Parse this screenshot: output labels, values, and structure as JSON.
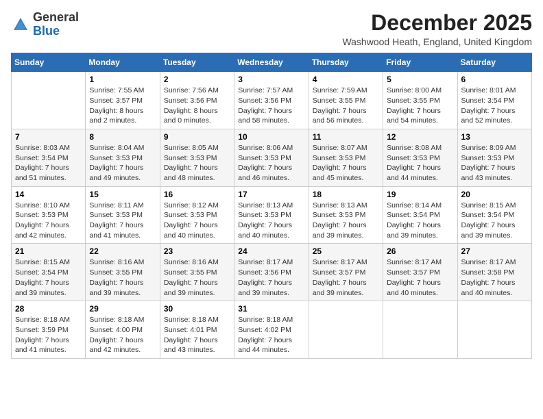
{
  "logo": {
    "general": "General",
    "blue": "Blue"
  },
  "header": {
    "month_year": "December 2025",
    "location": "Washwood Heath, England, United Kingdom"
  },
  "days_of_week": [
    "Sunday",
    "Monday",
    "Tuesday",
    "Wednesday",
    "Thursday",
    "Friday",
    "Saturday"
  ],
  "weeks": [
    [
      {
        "day": "",
        "info": ""
      },
      {
        "day": "1",
        "info": "Sunrise: 7:55 AM\nSunset: 3:57 PM\nDaylight: 8 hours\nand 2 minutes."
      },
      {
        "day": "2",
        "info": "Sunrise: 7:56 AM\nSunset: 3:56 PM\nDaylight: 8 hours\nand 0 minutes."
      },
      {
        "day": "3",
        "info": "Sunrise: 7:57 AM\nSunset: 3:56 PM\nDaylight: 7 hours\nand 58 minutes."
      },
      {
        "day": "4",
        "info": "Sunrise: 7:59 AM\nSunset: 3:55 PM\nDaylight: 7 hours\nand 56 minutes."
      },
      {
        "day": "5",
        "info": "Sunrise: 8:00 AM\nSunset: 3:55 PM\nDaylight: 7 hours\nand 54 minutes."
      },
      {
        "day": "6",
        "info": "Sunrise: 8:01 AM\nSunset: 3:54 PM\nDaylight: 7 hours\nand 52 minutes."
      }
    ],
    [
      {
        "day": "7",
        "info": "Sunrise: 8:03 AM\nSunset: 3:54 PM\nDaylight: 7 hours\nand 51 minutes."
      },
      {
        "day": "8",
        "info": "Sunrise: 8:04 AM\nSunset: 3:53 PM\nDaylight: 7 hours\nand 49 minutes."
      },
      {
        "day": "9",
        "info": "Sunrise: 8:05 AM\nSunset: 3:53 PM\nDaylight: 7 hours\nand 48 minutes."
      },
      {
        "day": "10",
        "info": "Sunrise: 8:06 AM\nSunset: 3:53 PM\nDaylight: 7 hours\nand 46 minutes."
      },
      {
        "day": "11",
        "info": "Sunrise: 8:07 AM\nSunset: 3:53 PM\nDaylight: 7 hours\nand 45 minutes."
      },
      {
        "day": "12",
        "info": "Sunrise: 8:08 AM\nSunset: 3:53 PM\nDaylight: 7 hours\nand 44 minutes."
      },
      {
        "day": "13",
        "info": "Sunrise: 8:09 AM\nSunset: 3:53 PM\nDaylight: 7 hours\nand 43 minutes."
      }
    ],
    [
      {
        "day": "14",
        "info": "Sunrise: 8:10 AM\nSunset: 3:53 PM\nDaylight: 7 hours\nand 42 minutes."
      },
      {
        "day": "15",
        "info": "Sunrise: 8:11 AM\nSunset: 3:53 PM\nDaylight: 7 hours\nand 41 minutes."
      },
      {
        "day": "16",
        "info": "Sunrise: 8:12 AM\nSunset: 3:53 PM\nDaylight: 7 hours\nand 40 minutes."
      },
      {
        "day": "17",
        "info": "Sunrise: 8:13 AM\nSunset: 3:53 PM\nDaylight: 7 hours\nand 40 minutes."
      },
      {
        "day": "18",
        "info": "Sunrise: 8:13 AM\nSunset: 3:53 PM\nDaylight: 7 hours\nand 39 minutes."
      },
      {
        "day": "19",
        "info": "Sunrise: 8:14 AM\nSunset: 3:54 PM\nDaylight: 7 hours\nand 39 minutes."
      },
      {
        "day": "20",
        "info": "Sunrise: 8:15 AM\nSunset: 3:54 PM\nDaylight: 7 hours\nand 39 minutes."
      }
    ],
    [
      {
        "day": "21",
        "info": "Sunrise: 8:15 AM\nSunset: 3:54 PM\nDaylight: 7 hours\nand 39 minutes."
      },
      {
        "day": "22",
        "info": "Sunrise: 8:16 AM\nSunset: 3:55 PM\nDaylight: 7 hours\nand 39 minutes."
      },
      {
        "day": "23",
        "info": "Sunrise: 8:16 AM\nSunset: 3:55 PM\nDaylight: 7 hours\nand 39 minutes."
      },
      {
        "day": "24",
        "info": "Sunrise: 8:17 AM\nSunset: 3:56 PM\nDaylight: 7 hours\nand 39 minutes."
      },
      {
        "day": "25",
        "info": "Sunrise: 8:17 AM\nSunset: 3:57 PM\nDaylight: 7 hours\nand 39 minutes."
      },
      {
        "day": "26",
        "info": "Sunrise: 8:17 AM\nSunset: 3:57 PM\nDaylight: 7 hours\nand 40 minutes."
      },
      {
        "day": "27",
        "info": "Sunrise: 8:17 AM\nSunset: 3:58 PM\nDaylight: 7 hours\nand 40 minutes."
      }
    ],
    [
      {
        "day": "28",
        "info": "Sunrise: 8:18 AM\nSunset: 3:59 PM\nDaylight: 7 hours\nand 41 minutes."
      },
      {
        "day": "29",
        "info": "Sunrise: 8:18 AM\nSunset: 4:00 PM\nDaylight: 7 hours\nand 42 minutes."
      },
      {
        "day": "30",
        "info": "Sunrise: 8:18 AM\nSunset: 4:01 PM\nDaylight: 7 hours\nand 43 minutes."
      },
      {
        "day": "31",
        "info": "Sunrise: 8:18 AM\nSunset: 4:02 PM\nDaylight: 7 hours\nand 44 minutes."
      },
      {
        "day": "",
        "info": ""
      },
      {
        "day": "",
        "info": ""
      },
      {
        "day": "",
        "info": ""
      }
    ]
  ]
}
